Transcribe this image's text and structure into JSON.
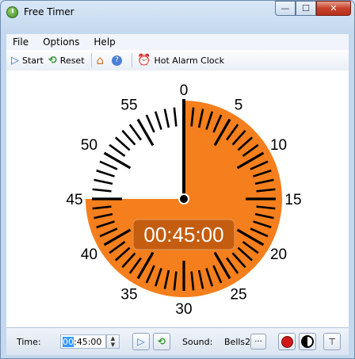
{
  "window": {
    "title": "Free Timer"
  },
  "menu": {
    "items": [
      "File",
      "Options",
      "Help"
    ]
  },
  "toolbar": {
    "start": "Start",
    "reset": "Reset",
    "alarm": "Hot Alarm Clock"
  },
  "timer": {
    "display": "00:45:00",
    "minute_labels": [
      "0",
      "5",
      "10",
      "15",
      "20",
      "25",
      "30",
      "35",
      "40",
      "45",
      "50",
      "55"
    ],
    "remaining_minutes": 45,
    "face_color": "#f47f1c",
    "display_bg": "#c05a10"
  },
  "status": {
    "time_label": "Time:",
    "time_value_sel": "00",
    "time_value_rest": ":45:00",
    "sound_label": "Sound:",
    "sound_value": "Bells2",
    "browse_label": "···"
  },
  "icons": {
    "start": "play-icon",
    "reset": "reset-icon",
    "home": "home-icon",
    "help": "help-icon",
    "alarm": "alarm-clock-icon",
    "record": "record-icon",
    "contrast": "contrast-icon",
    "pin": "pin-icon"
  }
}
